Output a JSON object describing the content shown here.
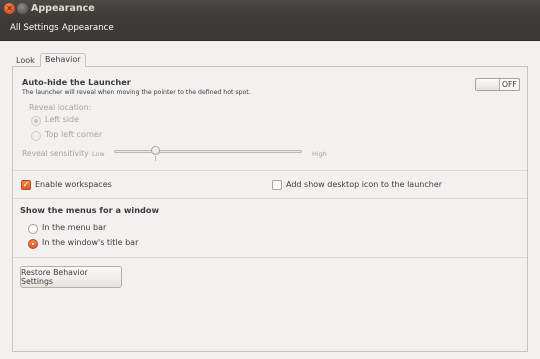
{
  "window": {
    "title": "Appearance"
  },
  "toolbar": {
    "all_settings": "All Settings",
    "appearance": "Appearance"
  },
  "tabs": [
    {
      "label": "Look"
    },
    {
      "label": "Behavior",
      "selected": true
    }
  ],
  "behavior": {
    "autohide": {
      "title": "Auto-hide the Launcher",
      "description": "The launcher will reveal when moving the pointer to the defined hot spot.",
      "switch_state": "OFF",
      "reveal_location_label": "Reveal location:",
      "options": [
        {
          "label": "Left side",
          "selected": true
        },
        {
          "label": "Top left corner",
          "selected": false
        }
      ],
      "sensitivity": {
        "label": "Reveal sensitivity",
        "low": "Low",
        "high": "High",
        "value": 0.22
      }
    },
    "enable_workspaces": {
      "label": "Enable workspaces",
      "checked": true
    },
    "desktop_icon": {
      "label": "Add show desktop icon to the launcher",
      "checked": false
    },
    "menus": {
      "title": "Show the menus for a window",
      "options": [
        {
          "label": "In the menu bar",
          "selected": false
        },
        {
          "label": "In the window's title bar",
          "selected": true
        }
      ]
    },
    "restore_button": "Restore Behavior Settings"
  },
  "colors": {
    "accent": "#e05a26",
    "titlebar": "#3c3b37",
    "background": "#f2f1f0"
  }
}
